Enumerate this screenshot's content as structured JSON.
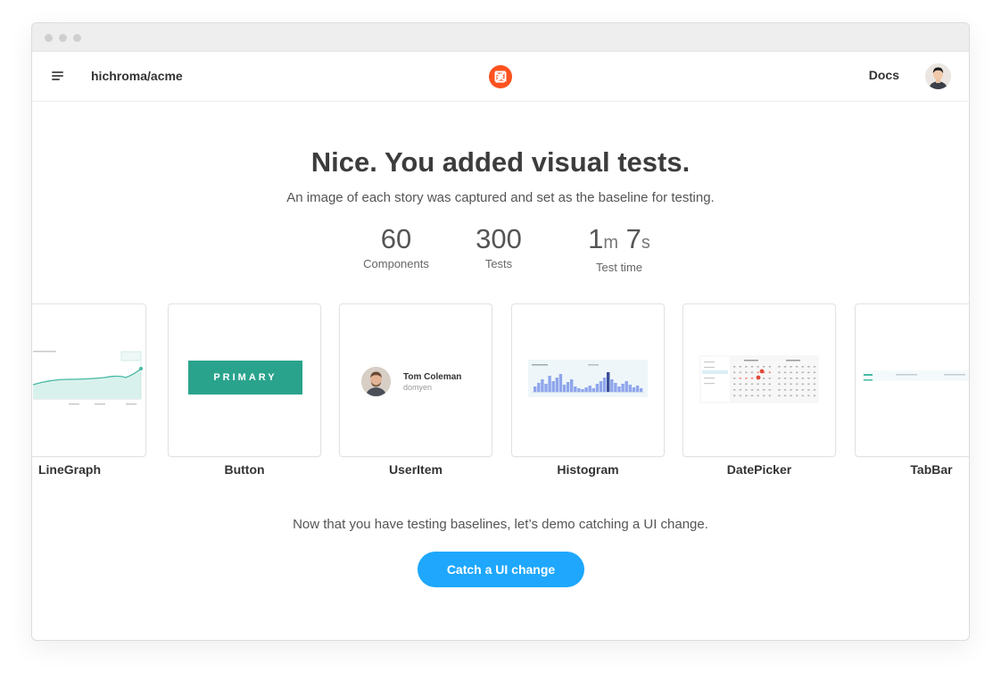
{
  "header": {
    "repo": "hichroma/acme",
    "docs_label": "Docs"
  },
  "main": {
    "headline": "Nice. You added visual tests.",
    "subheadline": "An image of each story was captured and set as the baseline for testing.",
    "stats": {
      "components": {
        "value": "60",
        "label": "Components"
      },
      "tests": {
        "value": "300",
        "label": "Tests"
      },
      "test_time": {
        "minutes": "1",
        "minutes_unit": "m",
        "seconds": "7",
        "seconds_unit": "s",
        "label": "Test time"
      }
    },
    "components": [
      {
        "label": "LineGraph"
      },
      {
        "label": "Button",
        "preview_text": "PRIMARY"
      },
      {
        "label": "UserItem",
        "preview_name": "Tom Coleman",
        "preview_handle": "domyen"
      },
      {
        "label": "Histogram"
      },
      {
        "label": "DatePicker"
      },
      {
        "label": "TabBar"
      }
    ],
    "footer_text": "Now that you have testing baselines, let’s demo catching a UI change.",
    "cta_label": "Catch a UI change"
  },
  "colors": {
    "accent": "#1ea7fd",
    "logo": "#fc521f",
    "button_preview": "#2aa38d",
    "histogram_bars": "#8fa6ec"
  }
}
